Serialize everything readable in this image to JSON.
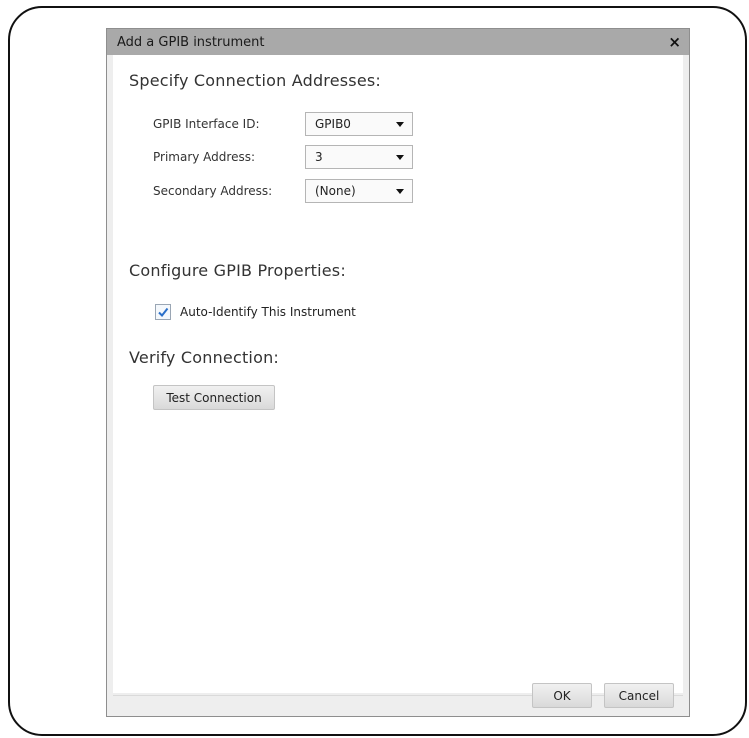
{
  "dialog": {
    "title": "Add a GPIB instrument",
    "close_glyph": "×",
    "close_icon": "close-icon"
  },
  "sections": {
    "addresses_heading": "Specify Connection Addresses:",
    "properties_heading": "Configure GPIB Properties:",
    "verify_heading": "Verify Connection:"
  },
  "fields": {
    "interface_label": "GPIB Interface ID:",
    "interface_value": "GPIB0",
    "primary_label": "Primary Address:",
    "primary_value": "3",
    "secondary_label": "Secondary Address:",
    "secondary_value": "(None)"
  },
  "properties": {
    "auto_identify_label": "Auto-Identify This Instrument",
    "auto_identify_checked": true
  },
  "buttons": {
    "test_connection": "Test Connection",
    "ok": "OK",
    "cancel": "Cancel"
  },
  "colors": {
    "titlebar": "#a9a9a9",
    "check_accent": "#2a6fc9"
  }
}
